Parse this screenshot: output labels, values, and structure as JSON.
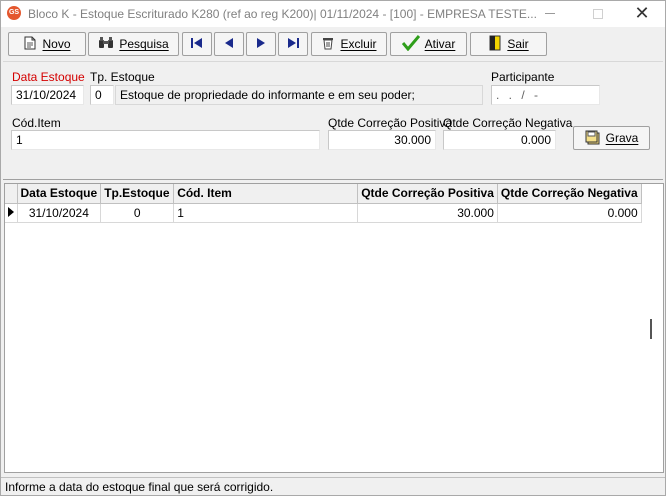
{
  "window": {
    "title": "Bloco K -  Estoque Escriturado K280 (ref ao reg K200)|  01/11/2024 - [100] - EMPRESA TESTE...",
    "app_icon_text": "GS",
    "controls": {
      "minimize": "",
      "maximize": "",
      "close": "✕"
    }
  },
  "toolbar": {
    "novo": "Novo",
    "pesquisa": "Pesquisa",
    "first": "",
    "prev": "",
    "next": "",
    "last": "",
    "excluir": "Excluir",
    "ativar": "Ativar",
    "sair": "Sair"
  },
  "form": {
    "data_estoque_label": "Data Estoque",
    "data_estoque_value": "31/10/2024",
    "tp_estoque_label": "Tp. Estoque",
    "tp_estoque_value": "0",
    "tp_estoque_desc": "Estoque de propriedade do informante e em seu poder;",
    "participante_label": "Participante",
    "participante_value": "  .   .   /    -",
    "cod_item_label": "Cód.Item",
    "cod_item_value": "1",
    "qtde_pos_label": "Qtde Correção Positiva",
    "qtde_pos_value": "30.000",
    "qtde_neg_label": "Qtde Correção Negativa",
    "qtde_neg_value": "0.000",
    "grava_label": "Grava"
  },
  "grid": {
    "headers": [
      "Data Estoque",
      "Tp.Estoque",
      "Cód. Item",
      "Qtde Correção Positiva",
      "Qtde Correção Negativa"
    ],
    "rows": [
      [
        "31/10/2024",
        "0",
        "1",
        "30.000",
        "0.000"
      ]
    ]
  },
  "status": {
    "text": "Informe a data do estoque final que será corrigido."
  },
  "colors": {
    "required_label": "#d40000",
    "ativar_icon": "#2e9e1a",
    "nav_icon": "#1a2a8c"
  }
}
